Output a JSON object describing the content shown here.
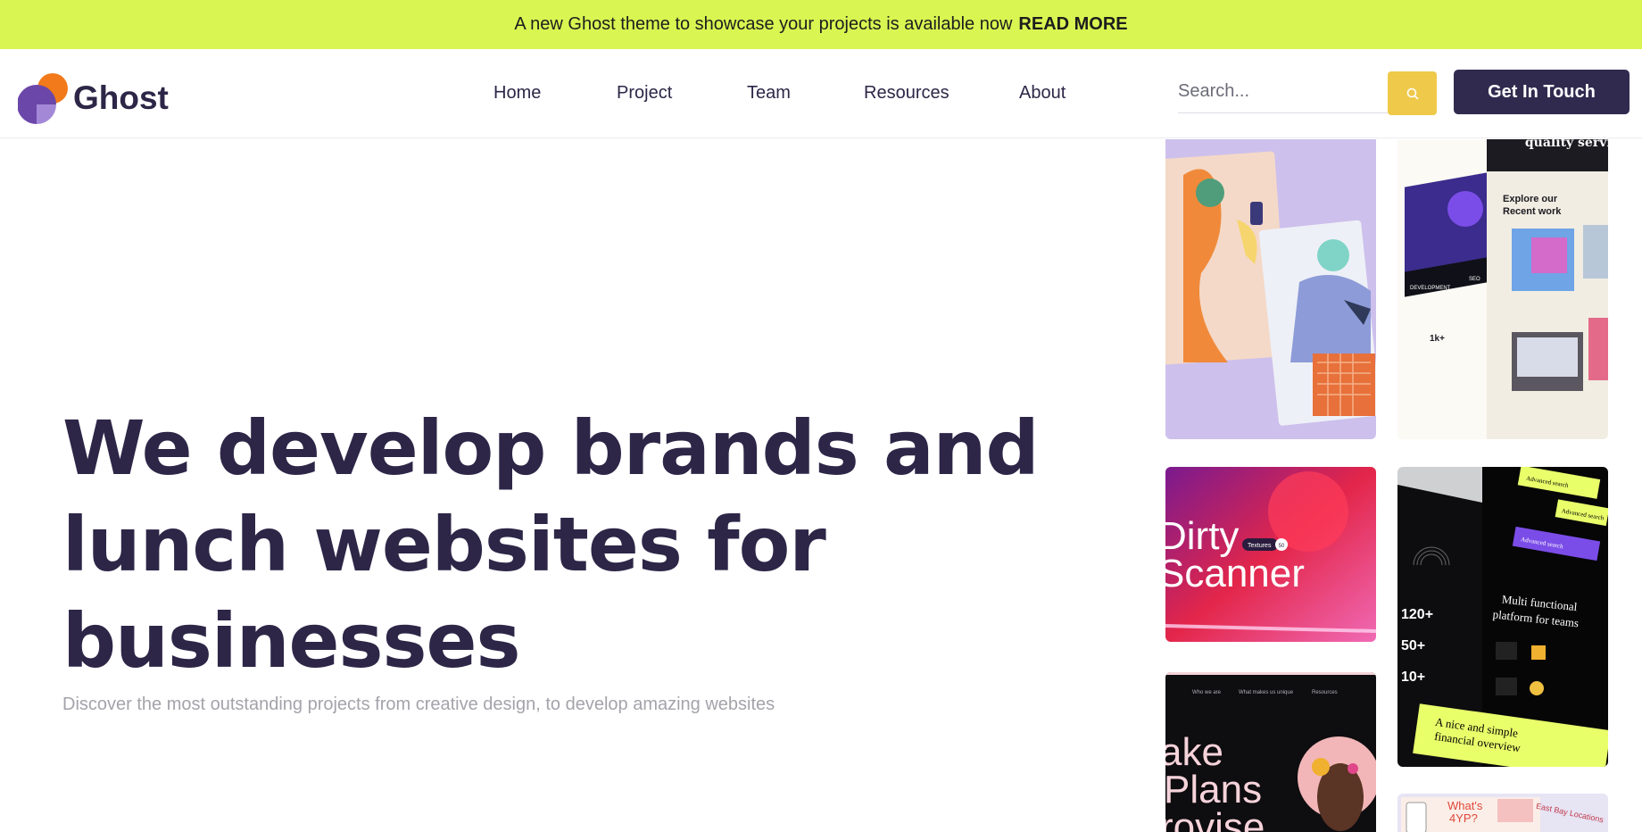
{
  "announcement": {
    "text": "A new Ghost theme to showcase your projects is available now",
    "link": "READ MORE"
  },
  "brand": {
    "name": "Ghost",
    "colors": {
      "orange": "#f27a1a",
      "purple": "#6b47a9",
      "lavender": "#a388d8"
    }
  },
  "nav": {
    "items": [
      "Home",
      "Project",
      "Team",
      "Resources",
      "About"
    ],
    "search_placeholder": "Search...",
    "search_icon": "search-icon",
    "cta": "Get In Touch"
  },
  "hero": {
    "title_lines": [
      "We develop brands and",
      "lunch websites for",
      "businesses"
    ],
    "subtitle": "Discover the most outstanding projects from creative design, to develop amazing websites"
  },
  "gallery": {
    "card1": {},
    "card2": {
      "heading_1": "quality service",
      "heading_2": "Explore our",
      "heading_3": "Recent work",
      "stat": "1k+",
      "tag_1": "DEVELOPMENT",
      "tag_2": "SEO"
    },
    "card3": {
      "word_1": "Dirty",
      "word_2": "Scanner",
      "tag": "Textures",
      "badge": "50"
    },
    "card4": {
      "heading_1": "Multi functional",
      "heading_2": "platform for teams",
      "stat_1": "120+",
      "stat_2": "50+",
      "stat_3": "10+",
      "chip_1": "Advanced search",
      "chip_2": "Advanced search",
      "chip_3": "Advanced search",
      "footer_1": "A nice and simple",
      "footer_2": "financial overview"
    },
    "card5": {
      "menu_1": "Who we are",
      "menu_2": "What makes us unique",
      "menu_3": "Resources",
      "word_1": "ake",
      "word_2": "Plans",
      "word_3": "rovise"
    },
    "card6": {
      "heading_1": "What's",
      "heading_2": "4YP?",
      "side": "East Bay Locations"
    }
  },
  "colors": {
    "announcement_bg": "#d9f552",
    "primary_dark": "#312a4f",
    "search_button": "#efc94a",
    "heading": "#2d2647",
    "subtitle": "#a3a3ab"
  }
}
